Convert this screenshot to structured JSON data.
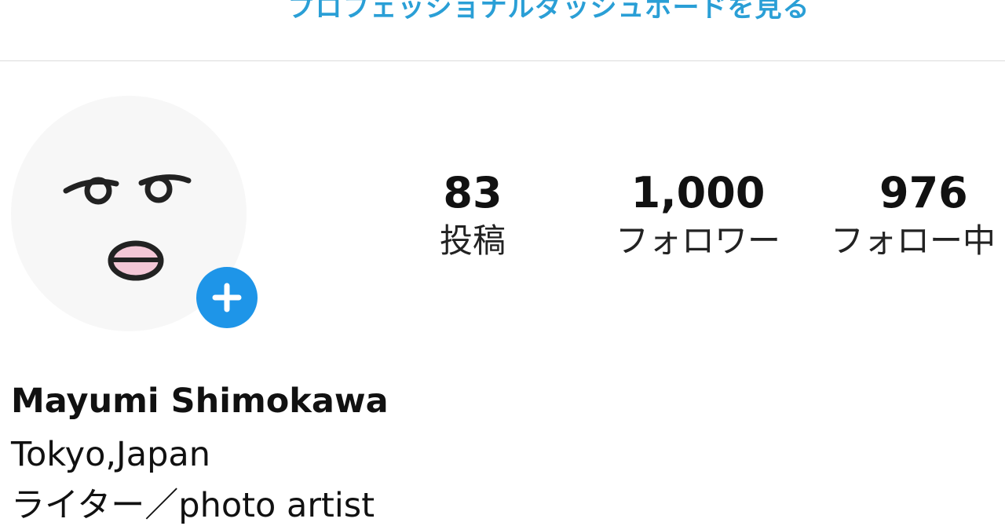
{
  "header": {
    "dashboard_link": "プロフェッショナルダッシュボードを見る"
  },
  "profile": {
    "avatar_icon": "face-doodle-avatar",
    "add_icon": "plus-icon",
    "accent_color": "#1e95e8",
    "name": "Mayumi Shimokawa",
    "bio": {
      "location": "Tokyo,Japan",
      "title": "ライター／photo artist"
    }
  },
  "stats": {
    "posts": {
      "value": "83",
      "label": "投稿"
    },
    "followers": {
      "value": "1,000",
      "label": "フォロワー"
    },
    "following": {
      "value": "976",
      "label": "フォロー中"
    }
  }
}
